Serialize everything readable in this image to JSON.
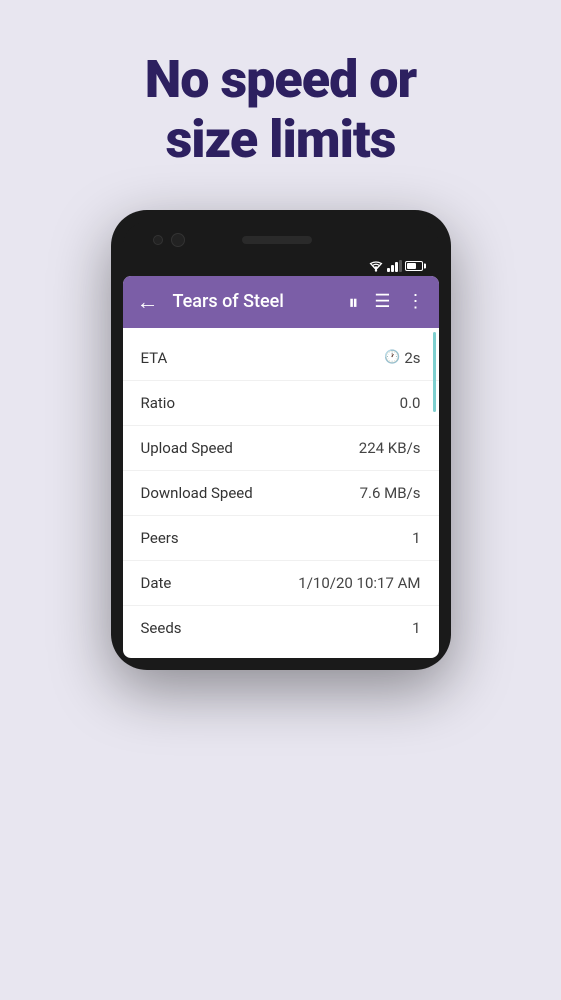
{
  "hero": {
    "line1": "No speed or",
    "line2": "size limits"
  },
  "toolbar": {
    "back_icon": "←",
    "title": "Tears of Steel",
    "pause_icon": "⏸",
    "list_icon": "☰",
    "more_icon": "⋮"
  },
  "info_rows": [
    {
      "label": "ETA",
      "value": "2s",
      "has_clock": true
    },
    {
      "label": "Ratio",
      "value": "0.0",
      "has_clock": false
    },
    {
      "label": "Upload Speed",
      "value": "224 KB/s",
      "has_clock": false
    },
    {
      "label": "Download Speed",
      "value": "7.6 MB/s",
      "has_clock": false
    },
    {
      "label": "Peers",
      "value": "1",
      "has_clock": false
    },
    {
      "label": "Date",
      "value": "1/10/20 10:17 AM",
      "has_clock": false
    },
    {
      "label": "Seeds",
      "value": "1",
      "has_clock": false
    }
  ]
}
